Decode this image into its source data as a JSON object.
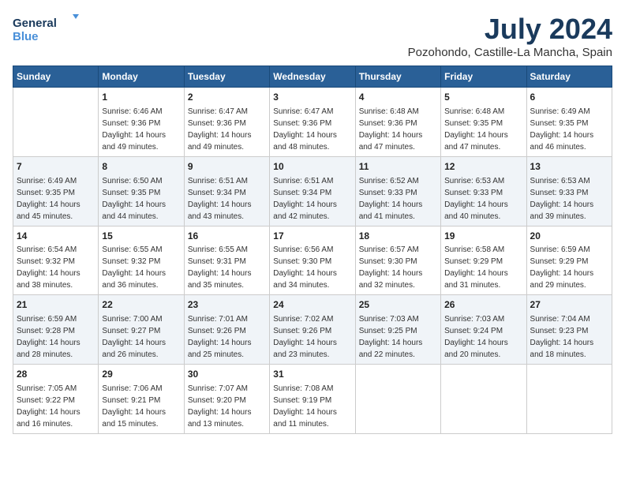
{
  "logo": {
    "line1": "General",
    "line2": "Blue"
  },
  "title": "July 2024",
  "location": "Pozohondo, Castille-La Mancha, Spain",
  "weekdays": [
    "Sunday",
    "Monday",
    "Tuesday",
    "Wednesday",
    "Thursday",
    "Friday",
    "Saturday"
  ],
  "weeks": [
    [
      {
        "day": "",
        "sunrise": "",
        "sunset": "",
        "daylight": ""
      },
      {
        "day": "1",
        "sunrise": "Sunrise: 6:46 AM",
        "sunset": "Sunset: 9:36 PM",
        "daylight": "Daylight: 14 hours and 49 minutes."
      },
      {
        "day": "2",
        "sunrise": "Sunrise: 6:47 AM",
        "sunset": "Sunset: 9:36 PM",
        "daylight": "Daylight: 14 hours and 49 minutes."
      },
      {
        "day": "3",
        "sunrise": "Sunrise: 6:47 AM",
        "sunset": "Sunset: 9:36 PM",
        "daylight": "Daylight: 14 hours and 48 minutes."
      },
      {
        "day": "4",
        "sunrise": "Sunrise: 6:48 AM",
        "sunset": "Sunset: 9:36 PM",
        "daylight": "Daylight: 14 hours and 47 minutes."
      },
      {
        "day": "5",
        "sunrise": "Sunrise: 6:48 AM",
        "sunset": "Sunset: 9:35 PM",
        "daylight": "Daylight: 14 hours and 47 minutes."
      },
      {
        "day": "6",
        "sunrise": "Sunrise: 6:49 AM",
        "sunset": "Sunset: 9:35 PM",
        "daylight": "Daylight: 14 hours and 46 minutes."
      }
    ],
    [
      {
        "day": "7",
        "sunrise": "Sunrise: 6:49 AM",
        "sunset": "Sunset: 9:35 PM",
        "daylight": "Daylight: 14 hours and 45 minutes."
      },
      {
        "day": "8",
        "sunrise": "Sunrise: 6:50 AM",
        "sunset": "Sunset: 9:35 PM",
        "daylight": "Daylight: 14 hours and 44 minutes."
      },
      {
        "day": "9",
        "sunrise": "Sunrise: 6:51 AM",
        "sunset": "Sunset: 9:34 PM",
        "daylight": "Daylight: 14 hours and 43 minutes."
      },
      {
        "day": "10",
        "sunrise": "Sunrise: 6:51 AM",
        "sunset": "Sunset: 9:34 PM",
        "daylight": "Daylight: 14 hours and 42 minutes."
      },
      {
        "day": "11",
        "sunrise": "Sunrise: 6:52 AM",
        "sunset": "Sunset: 9:33 PM",
        "daylight": "Daylight: 14 hours and 41 minutes."
      },
      {
        "day": "12",
        "sunrise": "Sunrise: 6:53 AM",
        "sunset": "Sunset: 9:33 PM",
        "daylight": "Daylight: 14 hours and 40 minutes."
      },
      {
        "day": "13",
        "sunrise": "Sunrise: 6:53 AM",
        "sunset": "Sunset: 9:33 PM",
        "daylight": "Daylight: 14 hours and 39 minutes."
      }
    ],
    [
      {
        "day": "14",
        "sunrise": "Sunrise: 6:54 AM",
        "sunset": "Sunset: 9:32 PM",
        "daylight": "Daylight: 14 hours and 38 minutes."
      },
      {
        "day": "15",
        "sunrise": "Sunrise: 6:55 AM",
        "sunset": "Sunset: 9:32 PM",
        "daylight": "Daylight: 14 hours and 36 minutes."
      },
      {
        "day": "16",
        "sunrise": "Sunrise: 6:55 AM",
        "sunset": "Sunset: 9:31 PM",
        "daylight": "Daylight: 14 hours and 35 minutes."
      },
      {
        "day": "17",
        "sunrise": "Sunrise: 6:56 AM",
        "sunset": "Sunset: 9:30 PM",
        "daylight": "Daylight: 14 hours and 34 minutes."
      },
      {
        "day": "18",
        "sunrise": "Sunrise: 6:57 AM",
        "sunset": "Sunset: 9:30 PM",
        "daylight": "Daylight: 14 hours and 32 minutes."
      },
      {
        "day": "19",
        "sunrise": "Sunrise: 6:58 AM",
        "sunset": "Sunset: 9:29 PM",
        "daylight": "Daylight: 14 hours and 31 minutes."
      },
      {
        "day": "20",
        "sunrise": "Sunrise: 6:59 AM",
        "sunset": "Sunset: 9:29 PM",
        "daylight": "Daylight: 14 hours and 29 minutes."
      }
    ],
    [
      {
        "day": "21",
        "sunrise": "Sunrise: 6:59 AM",
        "sunset": "Sunset: 9:28 PM",
        "daylight": "Daylight: 14 hours and 28 minutes."
      },
      {
        "day": "22",
        "sunrise": "Sunrise: 7:00 AM",
        "sunset": "Sunset: 9:27 PM",
        "daylight": "Daylight: 14 hours and 26 minutes."
      },
      {
        "day": "23",
        "sunrise": "Sunrise: 7:01 AM",
        "sunset": "Sunset: 9:26 PM",
        "daylight": "Daylight: 14 hours and 25 minutes."
      },
      {
        "day": "24",
        "sunrise": "Sunrise: 7:02 AM",
        "sunset": "Sunset: 9:26 PM",
        "daylight": "Daylight: 14 hours and 23 minutes."
      },
      {
        "day": "25",
        "sunrise": "Sunrise: 7:03 AM",
        "sunset": "Sunset: 9:25 PM",
        "daylight": "Daylight: 14 hours and 22 minutes."
      },
      {
        "day": "26",
        "sunrise": "Sunrise: 7:03 AM",
        "sunset": "Sunset: 9:24 PM",
        "daylight": "Daylight: 14 hours and 20 minutes."
      },
      {
        "day": "27",
        "sunrise": "Sunrise: 7:04 AM",
        "sunset": "Sunset: 9:23 PM",
        "daylight": "Daylight: 14 hours and 18 minutes."
      }
    ],
    [
      {
        "day": "28",
        "sunrise": "Sunrise: 7:05 AM",
        "sunset": "Sunset: 9:22 PM",
        "daylight": "Daylight: 14 hours and 16 minutes."
      },
      {
        "day": "29",
        "sunrise": "Sunrise: 7:06 AM",
        "sunset": "Sunset: 9:21 PM",
        "daylight": "Daylight: 14 hours and 15 minutes."
      },
      {
        "day": "30",
        "sunrise": "Sunrise: 7:07 AM",
        "sunset": "Sunset: 9:20 PM",
        "daylight": "Daylight: 14 hours and 13 minutes."
      },
      {
        "day": "31",
        "sunrise": "Sunrise: 7:08 AM",
        "sunset": "Sunset: 9:19 PM",
        "daylight": "Daylight: 14 hours and 11 minutes."
      },
      {
        "day": "",
        "sunrise": "",
        "sunset": "",
        "daylight": ""
      },
      {
        "day": "",
        "sunrise": "",
        "sunset": "",
        "daylight": ""
      },
      {
        "day": "",
        "sunrise": "",
        "sunset": "",
        "daylight": ""
      }
    ]
  ]
}
